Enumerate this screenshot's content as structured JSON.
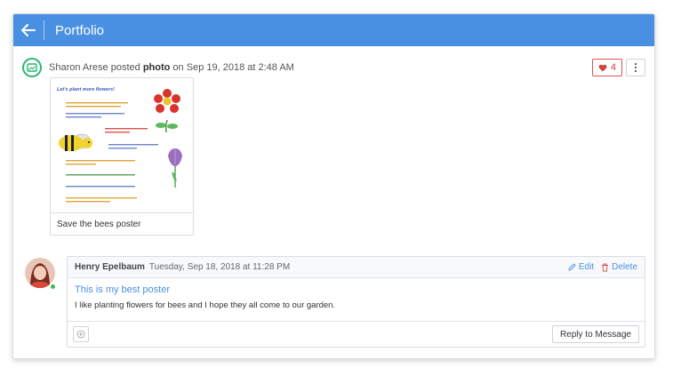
{
  "header": {
    "title": "Portfolio",
    "accent": "#4a90e2"
  },
  "post": {
    "author": "Sharon Arese",
    "verb": "posted",
    "type": "photo",
    "on_word": "on",
    "date": "Sep 19, 2018 at 2:48 AM",
    "like_count": "4",
    "photo_caption": "Save the bees poster",
    "poster_title": "Let's plant more flowers!"
  },
  "comment": {
    "author": "Henry Epelbaum",
    "date": "Tuesday, Sep 18, 2018 at 11:28 PM",
    "edit_label": "Edit",
    "delete_label": "Delete",
    "subject": "This is my best poster",
    "body": "I like planting flowers for bees and I hope they all come to our garden.",
    "reply_label": "Reply to Message"
  },
  "icons": {
    "back": "arrow-left-icon",
    "post_type": "image-icon",
    "like": "heart-icon",
    "more": "more-vertical-icon",
    "edit": "pencil-icon",
    "delete": "trash-icon",
    "add": "plus-icon"
  },
  "colors": {
    "online": "#3cba54",
    "like": "#e0524d",
    "post_icon": "#2bb673"
  }
}
